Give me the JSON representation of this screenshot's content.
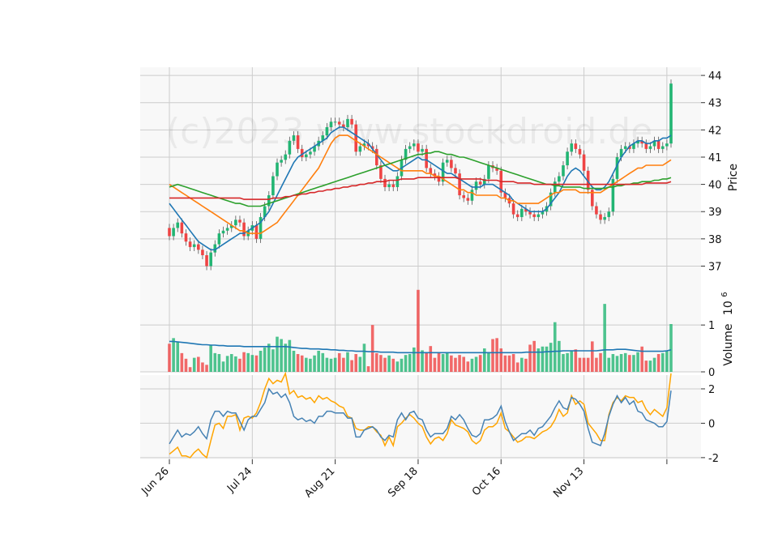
{
  "watermark": "(c)2023 www.stockdroid.de",
  "colors": {
    "up": "#22b573",
    "down": "#ef4444",
    "ma_fast": "#1f77b4",
    "ma_mid": "#ff7f0e",
    "ma_slow": "#2ca02c",
    "ma_long": "#d62728",
    "vol_ma": "#1f77b4",
    "osc1": "#4682b4",
    "osc2": "#ffa500",
    "grid": "#cccccc",
    "panel_bg": "#f8f8f8"
  },
  "chart_data": {
    "type": "candlestick",
    "x_tick_labels": [
      "Jun 26",
      "Jul 24",
      "Aug 21",
      "Sep 18",
      "Oct 16",
      "Nov 13"
    ],
    "x_tick_index": [
      0,
      20,
      40,
      60,
      80,
      100,
      120
    ],
    "price": {
      "ylabel": "Price",
      "yticks": [
        37,
        38,
        39,
        40,
        41,
        42,
        43,
        44
      ],
      "ylim": [
        36.3,
        44.3
      ],
      "close": [
        38.1,
        38.4,
        38.6,
        38.2,
        37.9,
        37.7,
        37.8,
        37.6,
        37.4,
        37.0,
        37.5,
        37.8,
        38.2,
        38.3,
        38.4,
        38.5,
        38.7,
        38.6,
        38.1,
        38.3,
        38.5,
        38.0,
        38.8,
        39.2,
        39.6,
        40.3,
        40.8,
        40.9,
        41.1,
        41.6,
        41.8,
        41.3,
        41.0,
        41.1,
        41.2,
        41.4,
        41.6,
        41.8,
        42.1,
        42.3,
        42.3,
        42.2,
        42.1,
        42.4,
        42.2,
        41.2,
        41.4,
        41.5,
        41.4,
        41.3,
        40.7,
        40.2,
        39.9,
        40.0,
        39.9,
        40.3,
        40.9,
        41.3,
        41.4,
        41.5,
        41.2,
        41.3,
        40.6,
        40.4,
        40.3,
        40.1,
        40.8,
        40.9,
        40.6,
        40.4,
        39.6,
        39.5,
        39.4,
        39.8,
        40.1,
        40.0,
        40.2,
        40.7,
        40.6,
        40.5,
        39.7,
        39.5,
        39.3,
        38.9,
        38.8,
        39.1,
        39.0,
        38.9,
        38.8,
        38.9,
        39.0,
        39.2,
        39.7,
        40.1,
        40.3,
        40.7,
        41.2,
        41.5,
        41.3,
        41.1,
        40.5,
        39.8,
        39.2,
        38.9,
        38.7,
        38.8,
        39.0,
        40.2,
        41.0,
        41.3,
        41.4,
        41.3,
        41.5,
        41.6,
        41.5,
        41.3,
        41.4,
        41.6,
        41.3,
        41.4,
        41.5,
        43.7
      ],
      "moving_averages": [
        {
          "color_key": "ma_fast",
          "values": [
            39.3,
            39.1,
            38.9,
            38.7,
            38.5,
            38.3,
            38.1,
            37.9,
            37.8,
            37.7,
            37.6,
            37.6,
            37.7,
            37.8,
            37.9,
            38.0,
            38.1,
            38.2,
            38.2,
            38.3,
            38.4,
            38.5,
            38.6,
            38.8,
            39.0,
            39.3,
            39.6,
            39.9,
            40.2,
            40.5,
            40.8,
            41.0,
            41.1,
            41.2,
            41.3,
            41.4,
            41.5,
            41.6,
            41.7,
            41.9,
            42.0,
            42.1,
            42.1,
            42.0,
            41.9,
            41.8,
            41.7,
            41.6,
            41.5,
            41.3,
            41.1,
            40.9,
            40.7,
            40.6,
            40.5,
            40.5,
            40.6,
            40.7,
            40.8,
            40.9,
            41.0,
            40.9,
            40.9,
            40.8,
            40.7,
            40.6,
            40.5,
            40.4,
            40.4,
            40.3,
            40.2,
            40.1,
            40.0,
            39.9,
            39.9,
            39.9,
            40.0,
            40.0,
            40.0,
            39.9,
            39.8,
            39.7,
            39.6,
            39.4,
            39.3,
            39.2,
            39.1,
            39.0,
            39.0,
            39.0,
            39.0,
            39.1,
            39.3,
            39.5,
            39.7,
            40.0,
            40.3,
            40.5,
            40.6,
            40.5,
            40.3,
            40.1,
            39.9,
            39.8,
            39.8,
            39.9,
            40.1,
            40.4,
            40.7,
            41.0,
            41.2,
            41.4,
            41.5,
            41.6,
            41.6,
            41.5,
            41.5,
            41.6,
            41.6,
            41.7,
            41.7,
            41.8
          ]
        },
        {
          "color_key": "ma_mid",
          "values": [
            40.0,
            39.9,
            39.8,
            39.7,
            39.6,
            39.5,
            39.4,
            39.3,
            39.2,
            39.1,
            39.0,
            38.9,
            38.8,
            38.7,
            38.6,
            38.5,
            38.4,
            38.3,
            38.3,
            38.2,
            38.2,
            38.2,
            38.2,
            38.3,
            38.4,
            38.5,
            38.6,
            38.8,
            39.0,
            39.2,
            39.4,
            39.6,
            39.8,
            40.0,
            40.2,
            40.4,
            40.6,
            40.9,
            41.2,
            41.5,
            41.7,
            41.8,
            41.8,
            41.8,
            41.7,
            41.6,
            41.5,
            41.4,
            41.3,
            41.2,
            41.1,
            41.0,
            40.9,
            40.8,
            40.7,
            40.6,
            40.5,
            40.5,
            40.5,
            40.5,
            40.5,
            40.5,
            40.4,
            40.4,
            40.3,
            40.3,
            40.2,
            40.1,
            40.0,
            39.9,
            39.8,
            39.8,
            39.7,
            39.7,
            39.6,
            39.6,
            39.6,
            39.6,
            39.6,
            39.6,
            39.5,
            39.5,
            39.4,
            39.4,
            39.3,
            39.3,
            39.3,
            39.3,
            39.3,
            39.3,
            39.4,
            39.5,
            39.6,
            39.7,
            39.7,
            39.8,
            39.8,
            39.8,
            39.8,
            39.7,
            39.7,
            39.7,
            39.7,
            39.7,
            39.7,
            39.8,
            39.9,
            40.0,
            40.1,
            40.2,
            40.3,
            40.4,
            40.5,
            40.6,
            40.6,
            40.7,
            40.7,
            40.7,
            40.7,
            40.7,
            40.8,
            40.9
          ]
        },
        {
          "color_key": "ma_slow",
          "values": [
            39.9,
            39.95,
            40.0,
            39.95,
            39.9,
            39.85,
            39.8,
            39.75,
            39.7,
            39.65,
            39.6,
            39.55,
            39.5,
            39.45,
            39.4,
            39.35,
            39.3,
            39.3,
            39.25,
            39.2,
            39.2,
            39.2,
            39.2,
            39.25,
            39.3,
            39.35,
            39.4,
            39.45,
            39.5,
            39.55,
            39.6,
            39.65,
            39.7,
            39.75,
            39.8,
            39.85,
            39.9,
            39.95,
            40.0,
            40.05,
            40.1,
            40.15,
            40.2,
            40.25,
            40.3,
            40.35,
            40.4,
            40.45,
            40.5,
            40.55,
            40.6,
            40.65,
            40.7,
            40.75,
            40.8,
            40.85,
            40.9,
            40.95,
            41.0,
            41.05,
            41.1,
            41.1,
            41.15,
            41.15,
            41.2,
            41.2,
            41.15,
            41.1,
            41.1,
            41.05,
            41.0,
            41.0,
            40.95,
            40.9,
            40.85,
            40.8,
            40.75,
            40.7,
            40.65,
            40.6,
            40.55,
            40.5,
            40.45,
            40.4,
            40.35,
            40.3,
            40.25,
            40.2,
            40.15,
            40.1,
            40.05,
            40.0,
            40.0,
            39.95,
            39.95,
            39.9,
            39.9,
            39.9,
            39.9,
            39.9,
            39.85,
            39.85,
            39.85,
            39.85,
            39.85,
            39.85,
            39.9,
            39.9,
            39.95,
            39.95,
            40.0,
            40.0,
            40.05,
            40.05,
            40.1,
            40.1,
            40.1,
            40.15,
            40.15,
            40.2,
            40.2,
            40.25
          ]
        },
        {
          "color_key": "ma_long",
          "values": [
            39.5,
            39.5,
            39.5,
            39.5,
            39.5,
            39.5,
            39.5,
            39.5,
            39.5,
            39.5,
            39.5,
            39.5,
            39.5,
            39.5,
            39.5,
            39.5,
            39.5,
            39.5,
            39.45,
            39.45,
            39.45,
            39.45,
            39.45,
            39.45,
            39.45,
            39.5,
            39.5,
            39.5,
            39.55,
            39.55,
            39.6,
            39.6,
            39.65,
            39.65,
            39.7,
            39.7,
            39.75,
            39.75,
            39.8,
            39.8,
            39.85,
            39.85,
            39.9,
            39.9,
            39.95,
            39.95,
            40.0,
            40.0,
            40.05,
            40.05,
            40.1,
            40.1,
            40.1,
            40.15,
            40.15,
            40.15,
            40.2,
            40.2,
            40.2,
            40.2,
            40.25,
            40.25,
            40.25,
            40.25,
            40.25,
            40.25,
            40.25,
            40.25,
            40.25,
            40.25,
            40.2,
            40.2,
            40.2,
            40.2,
            40.2,
            40.2,
            40.15,
            40.15,
            40.15,
            40.15,
            40.1,
            40.1,
            40.1,
            40.1,
            40.05,
            40.05,
            40.05,
            40.05,
            40.0,
            40.0,
            40.0,
            40.0,
            40.0,
            40.0,
            40.0,
            40.0,
            40.0,
            40.0,
            40.0,
            40.0,
            40.0,
            40.0,
            40.0,
            40.0,
            40.0,
            40.0,
            40.0,
            40.0,
            40.0,
            40.0,
            40.0,
            40.0,
            40.0,
            40.0,
            40.0,
            40.05,
            40.05,
            40.05,
            40.05,
            40.05,
            40.05,
            40.1
          ]
        }
      ]
    },
    "volume": {
      "ylabel": "Volume",
      "scale_label": "10",
      "scale_exp": "6",
      "yticks": [
        0,
        1
      ],
      "ylim": [
        0,
        1.85
      ],
      "values": [
        0.6,
        0.72,
        0.65,
        0.4,
        0.28,
        0.1,
        0.3,
        0.32,
        0.2,
        0.15,
        0.58,
        0.4,
        0.38,
        0.22,
        0.34,
        0.38,
        0.33,
        0.28,
        0.42,
        0.4,
        0.36,
        0.35,
        0.45,
        0.52,
        0.6,
        0.48,
        0.75,
        0.7,
        0.6,
        0.68,
        0.45,
        0.38,
        0.35,
        0.3,
        0.28,
        0.35,
        0.45,
        0.4,
        0.3,
        0.28,
        0.3,
        0.4,
        0.3,
        0.42,
        0.25,
        0.38,
        0.32,
        0.6,
        0.12,
        1.0,
        0.4,
        0.36,
        0.3,
        0.35,
        0.28,
        0.22,
        0.28,
        0.36,
        0.38,
        0.52,
        1.75,
        0.46,
        0.4,
        0.55,
        0.3,
        0.42,
        0.38,
        0.4,
        0.35,
        0.3,
        0.36,
        0.32,
        0.22,
        0.28,
        0.32,
        0.36,
        0.5,
        0.4,
        0.7,
        0.72,
        0.5,
        0.35,
        0.35,
        0.38,
        0.2,
        0.3,
        0.28,
        0.58,
        0.66,
        0.5,
        0.54,
        0.54,
        0.62,
        1.06,
        0.66,
        0.38,
        0.4,
        0.44,
        0.48,
        0.3,
        0.3,
        0.3,
        0.65,
        0.3,
        0.4,
        1.45,
        0.3,
        0.38,
        0.34,
        0.38,
        0.4,
        0.36,
        0.36,
        0.42,
        0.54,
        0.24,
        0.24,
        0.3,
        0.38,
        0.4,
        0.44,
        1.02
      ],
      "ma": [
        0.65,
        0.65,
        0.64,
        0.63,
        0.62,
        0.61,
        0.6,
        0.59,
        0.58,
        0.58,
        0.57,
        0.57,
        0.56,
        0.56,
        0.55,
        0.55,
        0.55,
        0.55,
        0.54,
        0.54,
        0.54,
        0.54,
        0.54,
        0.54,
        0.54,
        0.54,
        0.54,
        0.54,
        0.54,
        0.53,
        0.52,
        0.51,
        0.5,
        0.5,
        0.49,
        0.49,
        0.49,
        0.48,
        0.48,
        0.47,
        0.47,
        0.46,
        0.46,
        0.45,
        0.45,
        0.44,
        0.44,
        0.44,
        0.43,
        0.43,
        0.43,
        0.42,
        0.42,
        0.42,
        0.42,
        0.41,
        0.41,
        0.41,
        0.41,
        0.41,
        0.41,
        0.41,
        0.41,
        0.41,
        0.41,
        0.41,
        0.41,
        0.41,
        0.41,
        0.41,
        0.41,
        0.41,
        0.41,
        0.41,
        0.41,
        0.41,
        0.41,
        0.41,
        0.41,
        0.41,
        0.41,
        0.41,
        0.41,
        0.41,
        0.41,
        0.41,
        0.42,
        0.42,
        0.42,
        0.42,
        0.42,
        0.43,
        0.43,
        0.44,
        0.44,
        0.45,
        0.45,
        0.45,
        0.45,
        0.45,
        0.45,
        0.45,
        0.45,
        0.45,
        0.46,
        0.47,
        0.47,
        0.47,
        0.48,
        0.48,
        0.48,
        0.47,
        0.46,
        0.45,
        0.44,
        0.44,
        0.44,
        0.44,
        0.44,
        0.44,
        0.45,
        0.47
      ]
    },
    "oscillator": {
      "yticks": [
        -2,
        0,
        2
      ],
      "ylim": [
        -2.1,
        2.8
      ],
      "line1": [
        -1.2,
        -0.8,
        -0.4,
        -0.8,
        -0.6,
        -0.7,
        -0.5,
        -0.2,
        -0.6,
        -0.9,
        0.2,
        0.7,
        0.7,
        0.4,
        0.7,
        0.6,
        0.6,
        0.1,
        -0.4,
        0.2,
        0.4,
        0.4,
        0.8,
        1.2,
        2.0,
        1.7,
        1.8,
        1.5,
        1.7,
        1.2,
        0.4,
        0.2,
        0.3,
        0.1,
        0.2,
        0.0,
        0.4,
        0.4,
        0.7,
        0.7,
        0.6,
        0.6,
        0.6,
        0.3,
        0.3,
        -0.8,
        -0.8,
        -0.4,
        -0.3,
        -0.2,
        -0.4,
        -0.8,
        -1.0,
        -0.7,
        -0.8,
        0.2,
        0.6,
        0.2,
        0.6,
        0.7,
        0.3,
        0.2,
        -0.4,
        -0.8,
        -0.6,
        -0.6,
        -0.6,
        -0.3,
        0.4,
        0.2,
        0.5,
        0.2,
        -0.3,
        -0.7,
        -0.8,
        -0.6,
        0.2,
        0.2,
        0.3,
        0.5,
        1.0,
        0.1,
        -0.5,
        -1.0,
        -0.8,
        -0.6,
        -0.6,
        -0.4,
        -0.7,
        -0.3,
        -0.2,
        0.1,
        0.4,
        0.9,
        1.3,
        0.9,
        0.8,
        1.5,
        1.4,
        1.1,
        0.7,
        -0.3,
        -1.1,
        -1.2,
        -1.3,
        -0.6,
        0.4,
        1.1,
        1.6,
        1.2,
        1.5,
        1.1,
        1.3,
        0.7,
        0.6,
        0.2,
        0.1,
        0.0,
        -0.2,
        -0.2,
        0.1,
        1.9
      ],
      "line2": [
        -1.8,
        -1.6,
        -1.4,
        -1.9,
        -1.9,
        -2.0,
        -1.7,
        -1.5,
        -1.8,
        -2.0,
        -1.0,
        -0.1,
        0.0,
        -0.3,
        0.4,
        0.4,
        0.5,
        -0.4,
        0.3,
        0.4,
        0.3,
        0.6,
        1.2,
        2.0,
        2.6,
        2.3,
        2.5,
        2.4,
        2.9,
        1.7,
        1.9,
        1.5,
        1.6,
        1.4,
        1.5,
        1.2,
        1.6,
        1.4,
        1.5,
        1.3,
        1.2,
        1.0,
        0.9,
        0.4,
        0.3,
        -0.3,
        -0.4,
        -0.4,
        -0.2,
        -0.2,
        -0.5,
        -0.7,
        -1.3,
        -0.8,
        -1.3,
        -0.2,
        0.0,
        0.3,
        0.5,
        0.3,
        0.0,
        -0.2,
        -0.8,
        -1.2,
        -0.9,
        -0.8,
        -1.0,
        -0.6,
        0.2,
        -0.1,
        -0.2,
        -0.3,
        -0.5,
        -1.0,
        -1.2,
        -1.0,
        -0.4,
        -0.2,
        -0.2,
        0.0,
        0.6,
        -0.3,
        -0.5,
        -0.8,
        -1.1,
        -1.0,
        -0.8,
        -0.8,
        -0.9,
        -0.7,
        -0.5,
        -0.4,
        -0.2,
        0.2,
        0.8,
        0.4,
        0.6,
        1.6,
        1.1,
        1.3,
        1.1,
        0.0,
        -0.3,
        -0.6,
        -1.0,
        -1.0,
        0.5,
        1.2,
        1.5,
        1.3,
        1.6,
        1.5,
        1.5,
        1.2,
        1.3,
        0.8,
        0.5,
        0.8,
        0.6,
        0.4,
        0.9,
        2.9
      ]
    }
  }
}
